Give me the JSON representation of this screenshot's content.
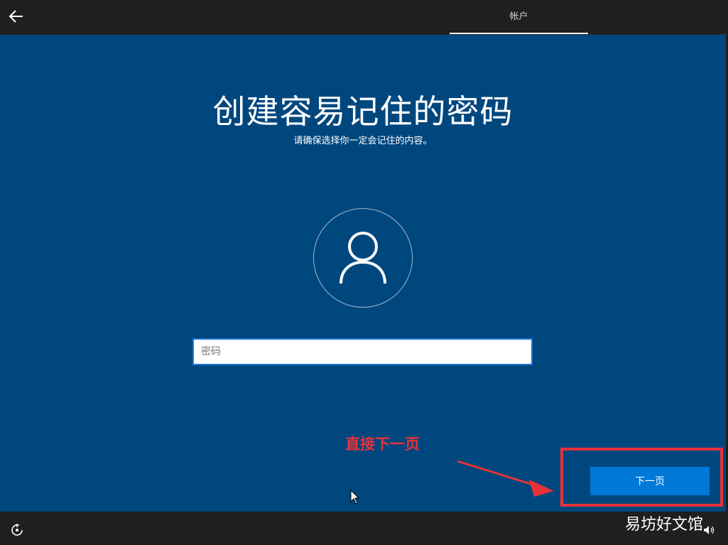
{
  "header": {
    "tab_label": "帐户"
  },
  "main": {
    "title": "创建容易记住的密码",
    "subtitle": "请确保选择你一定会记住的内容。",
    "password": {
      "placeholder": "密码",
      "value": ""
    },
    "next_label": "下一页"
  },
  "annotation": {
    "text": "直接下一页",
    "color": "#e8323a"
  },
  "footer": {
    "watermark": "易坊好文馆"
  },
  "colors": {
    "background": "#00477e",
    "accent": "#0078d7"
  },
  "icons": [
    "back-arrow-icon",
    "user-icon",
    "ease-of-access-icon",
    "volume-icon",
    "mouse-cursor-icon"
  ]
}
